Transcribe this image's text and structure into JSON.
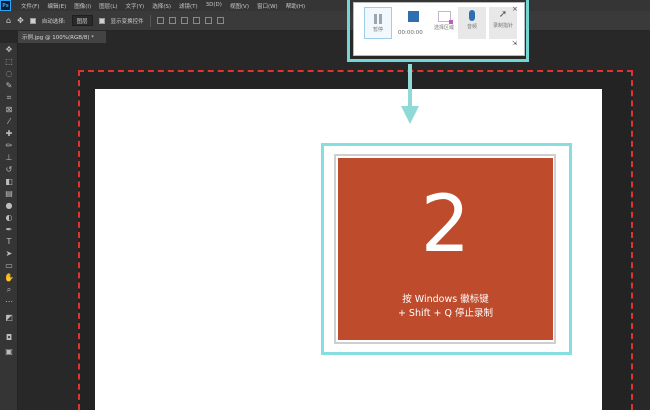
{
  "app": {
    "logo": "Ps"
  },
  "menu": [
    "文件(F)",
    "编辑(E)",
    "图像(I)",
    "图层(L)",
    "文字(Y)",
    "选择(S)",
    "滤镜(T)",
    "3D(D)",
    "视图(V)",
    "窗口(W)",
    "帮助(H)"
  ],
  "options": {
    "auto_select_label": "自动选择:",
    "layer_dropdown": "图层",
    "show_transform_label": "显示变换控件"
  },
  "tab": {
    "title": "示例.jpg @ 100%(RGB/8) *"
  },
  "canvas": {
    "big_number": "2",
    "hint_line1": "按 Windows 徽标键",
    "hint_line2": "+ Shift + Q 停止录制",
    "red_color": "#bd4b2c",
    "frame_color": "#86dede",
    "dashed_color": "#e0322e"
  },
  "recorder": {
    "pause_label": "暂停",
    "timer": "00:00:00",
    "select_area_label": "选择区域",
    "audio_label": "音频",
    "pointer_label": "录制指针",
    "close_glyph": "×",
    "pin_glyph": "⇲"
  },
  "colors": {
    "accent_teal": "#72d6d2",
    "stop_blue": "#2f6fb0"
  }
}
